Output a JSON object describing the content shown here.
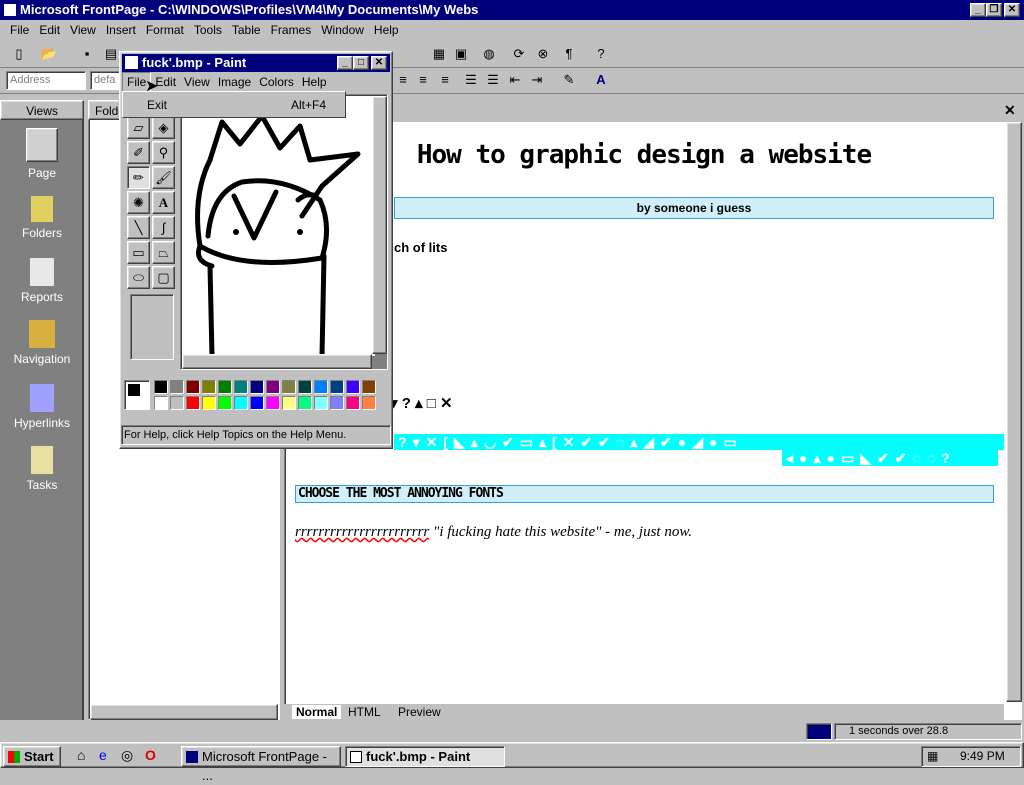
{
  "frontpage": {
    "title": "Microsoft FrontPage - C:\\WINDOWS\\Profiles\\VM4\\My Documents\\My Webs",
    "menu": [
      "File",
      "Edit",
      "View",
      "Insert",
      "Format",
      "Tools",
      "Table",
      "Frames",
      "Window",
      "Help"
    ],
    "address_placeholder": "Address",
    "style_value": "defa",
    "views_header": "Views",
    "views": [
      "Page",
      "Folders",
      "Reports",
      "Navigation",
      "Hyperlinks",
      "Tasks"
    ],
    "folder_header": "Folde",
    "page": {
      "heading": "How to graphic design a website",
      "byline": "by someone i guess",
      "partial_text": "ch of lits",
      "section2": "CHOOSE THE MOST ANNOYING FONTS",
      "body_r": "rrrrrrrrrrrrrrrrrrrrrrr",
      "body_quote": "\"i fucking hate this website\" - me, just now.",
      "symbols_row": "▾ ? ▴ □ ✕"
    },
    "tabs": [
      "Normal",
      "HTML",
      "Preview"
    ],
    "status": "1 seconds over 28.8"
  },
  "paint": {
    "title": "fuck'.bmp - Paint",
    "menu": [
      "File",
      "Edit",
      "View",
      "Image",
      "Colors",
      "Help"
    ],
    "file_menu": {
      "item": "Exit",
      "shortcut": "Alt+F4"
    },
    "status": "For Help, click Help Topics on the Help Menu.",
    "palette_top": [
      "#000000",
      "#808080",
      "#800000",
      "#808000",
      "#008000",
      "#008080",
      "#000080",
      "#800080",
      "#808040",
      "#004040",
      "#0080ff",
      "#004080",
      "#4000ff",
      "#804000"
    ],
    "palette_bottom": [
      "#ffffff",
      "#c0c0c0",
      "#ff0000",
      "#ffff00",
      "#00ff00",
      "#00ffff",
      "#0000ff",
      "#ff00ff",
      "#ffff80",
      "#00ff80",
      "#80ffff",
      "#8080ff",
      "#ff0080",
      "#ff8040"
    ]
  },
  "taskbar": {
    "start": "Start",
    "tasks": [
      "Microsoft FrontPage - ...",
      "fuck'.bmp - Paint"
    ],
    "clock": "9:49 PM"
  },
  "colors": {
    "titlebar": "#00007c",
    "cyan": "#00ffff",
    "banner": "#cfeffa"
  }
}
